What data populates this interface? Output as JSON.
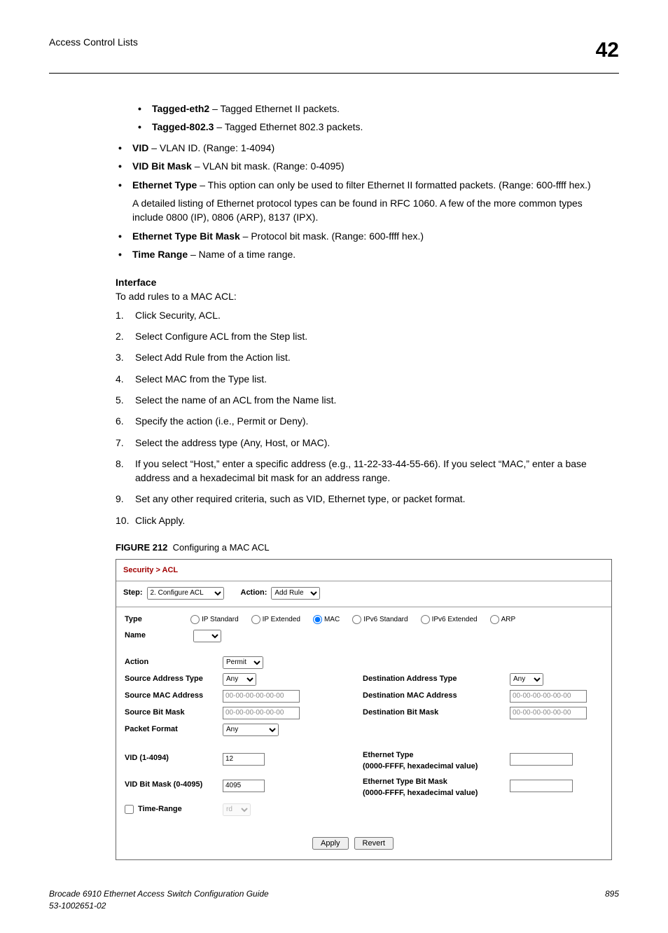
{
  "header": {
    "left": "Access Control Lists",
    "right": "42"
  },
  "nested_bullets": [
    {
      "term": "Tagged-eth2",
      "desc": " – Tagged Ethernet II packets."
    },
    {
      "term": "Tagged-802.3",
      "desc": " – Tagged Ethernet 802.3 packets."
    }
  ],
  "top_bullets": [
    {
      "term": "VID",
      "desc": " – VLAN ID. (Range: 1-4094)"
    },
    {
      "term": "VID Bit Mask",
      "desc": " – VLAN bit mask. (Range: 0-4095)"
    },
    {
      "term": "Ethernet Type",
      "desc": " – This option can only be used to filter Ethernet II formatted packets. (Range: 600-ffff hex.)",
      "extra": "A detailed listing of Ethernet protocol types can be found in RFC 1060. A few of the more common types include 0800 (IP), 0806 (ARP), 8137 (IPX)."
    },
    {
      "term": "Ethernet Type Bit Mask",
      "desc": " – Protocol bit mask. (Range: 600-ffff hex.)"
    },
    {
      "term": "Time Range",
      "desc": " – Name of a time range."
    }
  ],
  "interface": {
    "heading": "Interface",
    "intro": "To add rules to a MAC ACL:",
    "steps": [
      "Click Security, ACL.",
      "Select Configure ACL from the Step list.",
      "Select Add Rule from the Action list.",
      "Select MAC from the Type list.",
      "Select the name of an ACL from the Name list.",
      "Specify the action (i.e., Permit or Deny).",
      "Select the address type (Any, Host, or MAC).",
      "If you select “Host,” enter a specific address (e.g., 11-22-33-44-55-66). If you select “MAC,” enter a base address and a hexadecimal bit mask for an address range.",
      "Set any other required criteria, such as VID, Ethernet type, or packet format.",
      "Click Apply."
    ]
  },
  "figure": {
    "label": "FIGURE 212",
    "caption": "Configuring a MAC ACL"
  },
  "panel": {
    "title": "Security > ACL",
    "step_label": "Step:",
    "step_value": "2. Configure ACL",
    "action_label": "Action:",
    "action_value": "Add Rule",
    "type_label": "Type",
    "type_options": [
      "IP Standard",
      "IP Extended",
      "MAC",
      "IPv6 Standard",
      "IPv6 Extended",
      "ARP"
    ],
    "type_selected": "MAC",
    "name_label": "Name",
    "action2_label": "Action",
    "action2_value": "Permit",
    "rows_left": [
      {
        "label": "Source Address Type",
        "type": "select",
        "value": "Any"
      },
      {
        "label": "Source MAC Address",
        "type": "text",
        "value": "00-00-00-00-00-00"
      },
      {
        "label": "Source Bit Mask",
        "type": "text",
        "value": "00-00-00-00-00-00"
      },
      {
        "label": "Packet Format",
        "type": "select",
        "value": "Any",
        "wide": true
      }
    ],
    "rows_right": [
      {
        "label": "Destination Address Type",
        "type": "select",
        "value": "Any"
      },
      {
        "label": "Destination MAC Address",
        "type": "text",
        "value": "00-00-00-00-00-00"
      },
      {
        "label": "Destination Bit Mask",
        "type": "text",
        "value": "00-00-00-00-00-00"
      }
    ],
    "vid_label": "VID (1-4094)",
    "vid_value": "12",
    "eth_type_label": "Ethernet Type",
    "eth_type_sub": "(0000-FFFF, hexadecimal value)",
    "eth_type_value": "",
    "vid_mask_label": "VID Bit Mask (0-4095)",
    "vid_mask_value": "4095",
    "eth_mask_label": "Ethernet Type Bit Mask",
    "eth_mask_sub": "(0000-FFFF, hexadecimal value)",
    "eth_mask_value": "",
    "time_range_label": "Time-Range",
    "time_range_value": "rd",
    "apply_label": "Apply",
    "revert_label": "Revert"
  },
  "footer": {
    "left_line1": "Brocade 6910 Ethernet Access Switch Configuration Guide",
    "left_line2": "53-1002651-02",
    "right": "895"
  }
}
